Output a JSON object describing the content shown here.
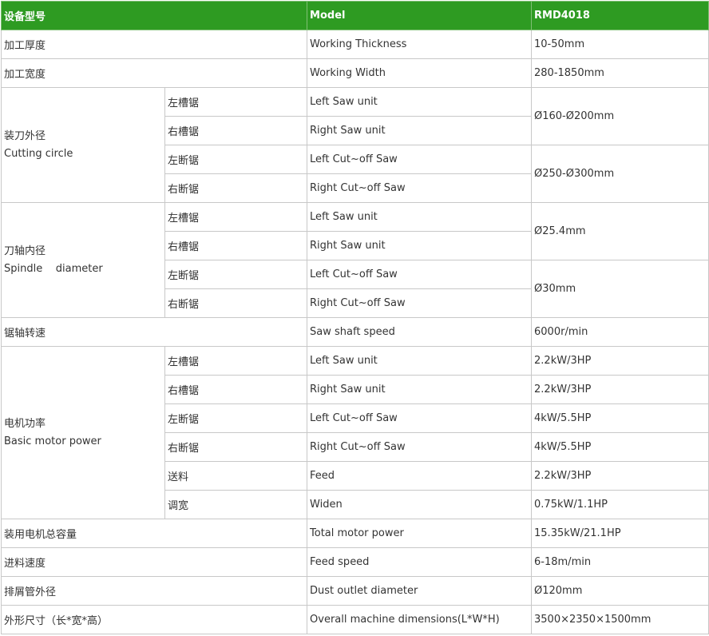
{
  "header": {
    "cn": "设备型号",
    "en": "Model",
    "value": "RMD4018"
  },
  "rows": {
    "thickness": {
      "cn": "加工厚度",
      "en": "Working Thickness",
      "value": "10-50mm"
    },
    "width": {
      "cn": "加工宽度",
      "en": "Working Width",
      "value": "280-1850mm"
    },
    "saw_speed": {
      "cn": "锯轴转速",
      "en": "Saw shaft speed",
      "value": "6000r/min"
    },
    "total_power": {
      "cn": "装用电机总容量",
      "en": "Total motor power",
      "value": "15.35kW/21.1HP"
    },
    "feed_speed": {
      "cn": "进料速度",
      "en": "Feed speed",
      "value": "6-18m/min"
    },
    "dust_outlet": {
      "cn": "排屑管外径",
      "en": "Dust outlet diameter",
      "value": "Ø120mm"
    },
    "dimensions": {
      "cn": "外形尺寸（长*宽*高）",
      "en": "Overall machine dimensions(L*W*H)",
      "value": "3500×2350×1500mm"
    }
  },
  "cutting_circle": {
    "cn": "装刀外径",
    "en": "Cutting circle",
    "items": [
      {
        "cn": "左槽锯",
        "en": "Left Saw unit"
      },
      {
        "cn": "右槽锯",
        "en": "Right Saw unit"
      },
      {
        "cn": "左断锯",
        "en": "Left Cut~off Saw"
      },
      {
        "cn": "右断锯",
        "en": "Right Cut~off Saw"
      }
    ],
    "values": [
      "Ø160-Ø200mm",
      "Ø250-Ø300mm"
    ]
  },
  "spindle": {
    "cn": "刀轴内径",
    "en": "Spindle    diameter",
    "items": [
      {
        "cn": "左槽锯",
        "en": "Left Saw unit"
      },
      {
        "cn": "右槽锯",
        "en": "Right Saw unit"
      },
      {
        "cn": "左断锯",
        "en": "Left Cut~off Saw"
      },
      {
        "cn": "右断锯",
        "en": "Right Cut~off Saw"
      }
    ],
    "values": [
      "Ø25.4mm",
      "Ø30mm"
    ]
  },
  "motor": {
    "cn": "电机功率",
    "en": "Basic motor power",
    "items": [
      {
        "cn": "左槽锯",
        "en": "Left Saw unit",
        "value": "2.2kW/3HP"
      },
      {
        "cn": "右槽锯",
        "en": "Right Saw unit",
        "value": "2.2kW/3HP"
      },
      {
        "cn": "左断锯",
        "en": "Left Cut~off Saw",
        "value": "4kW/5.5HP"
      },
      {
        "cn": "右断锯",
        "en": "Right Cut~off Saw",
        "value": "4kW/5.5HP"
      },
      {
        "cn": "送料",
        "en": "Feed",
        "value": "2.2kW/3HP"
      },
      {
        "cn": "调宽",
        "en": "Widen",
        "value": "0.75kW/1.1HP"
      }
    ]
  }
}
